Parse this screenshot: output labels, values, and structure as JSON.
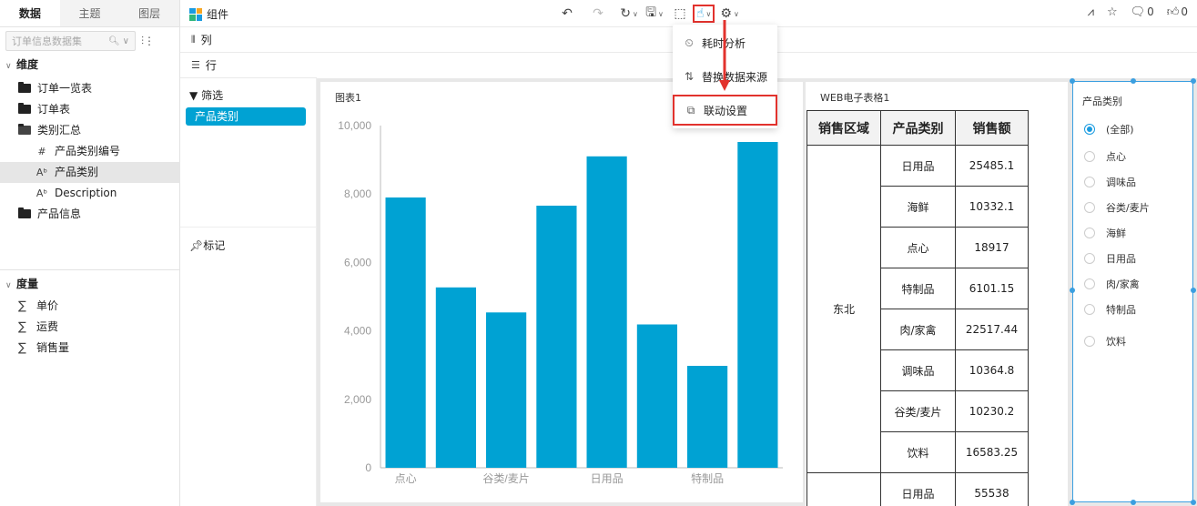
{
  "left_panel": {
    "tabs": [
      "数据",
      "主题",
      "图层"
    ],
    "search_placeholder": "订单信息数据集",
    "dimension": {
      "title": "维度",
      "items": [
        {
          "label": "订单一览表",
          "type": "folder"
        },
        {
          "label": "订单表",
          "type": "folder"
        },
        {
          "label": "类别汇总",
          "type": "folder-open"
        },
        {
          "label": "产品类别编号",
          "type": "number-field"
        },
        {
          "label": "产品类别",
          "type": "text-field"
        },
        {
          "label": "Description",
          "type": "text-field"
        },
        {
          "label": "产品信息",
          "type": "folder"
        }
      ]
    },
    "measure": {
      "title": "度量",
      "items": [
        "单价",
        "运费",
        "销售量"
      ]
    }
  },
  "toolbar": {
    "component_label": "组件",
    "counts": {
      "comments": "0",
      "likes": "0"
    }
  },
  "shelves": {
    "columns_label": "列",
    "rows_label": "行"
  },
  "filter_panel": {
    "filter_title": "筛选",
    "filter_pill": "产品类别",
    "mark_title": "标记"
  },
  "chart_card": {
    "title": "图表1"
  },
  "chart_data": {
    "type": "bar",
    "categories": [
      "点心",
      "",
      "谷类/麦片",
      "",
      "日用品",
      "",
      "特制品",
      ""
    ],
    "values": [
      7900,
      5270,
      4540,
      7660,
      9100,
      4190,
      2980,
      9520
    ],
    "xlabel": "",
    "ylabel": "",
    "ylim": [
      0,
      10000
    ],
    "y_ticks": [
      "0",
      "2,000",
      "4,000",
      "6,000",
      "8,000",
      "10,000"
    ],
    "bar_color": "#00a2d3",
    "grid": false
  },
  "table_card": {
    "title": "WEB电子表格1",
    "headers": [
      "销售区域",
      "产品类别",
      "销售额"
    ],
    "region": "东北",
    "rows": [
      {
        "category": "日用品",
        "sales": "25485.1"
      },
      {
        "category": "海鲜",
        "sales": "10332.1"
      },
      {
        "category": "点心",
        "sales": "18917"
      },
      {
        "category": "特制品",
        "sales": "6101.15"
      },
      {
        "category": "肉/家禽",
        "sales": "22517.44"
      },
      {
        "category": "调味品",
        "sales": "10364.8"
      },
      {
        "category": "谷类/麦片",
        "sales": "10230.2"
      },
      {
        "category": "饮料",
        "sales": "16583.25"
      }
    ],
    "next_row": {
      "category": "日用品",
      "sales": "55538"
    }
  },
  "filter_card": {
    "title": "产品类别",
    "options": [
      "(全部)",
      "点心",
      "调味品",
      "谷类/麦片",
      "海鲜",
      "日用品",
      "肉/家禽",
      "特制品",
      "饮料"
    ],
    "selected": "(全部)"
  },
  "dropdown_menu": {
    "items": [
      "耗时分析",
      "替换数据来源",
      "联动设置"
    ],
    "highlighted": "联动设置"
  },
  "colors": {
    "accent": "#00a2d3",
    "highlight_red": "#e2322d",
    "selection_blue": "#3b9fe0"
  }
}
